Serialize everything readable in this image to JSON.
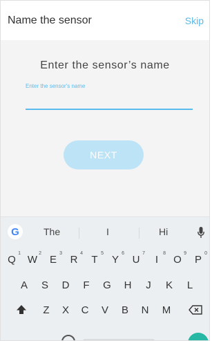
{
  "app_bar": {
    "title": "Name the sensor",
    "skip_label": "Skip"
  },
  "form": {
    "heading": "Enter the sensor’s name",
    "field_label": "Enter the sensor's name",
    "field_value": "",
    "next_label": "NEXT"
  },
  "keyboard": {
    "suggestions": [
      "The",
      "I",
      "Hi"
    ],
    "row1": [
      {
        "key": "Q",
        "num": "1"
      },
      {
        "key": "W",
        "num": "2"
      },
      {
        "key": "E",
        "num": "3"
      },
      {
        "key": "R",
        "num": "4"
      },
      {
        "key": "T",
        "num": "5"
      },
      {
        "key": "Y",
        "num": "6"
      },
      {
        "key": "U",
        "num": "7"
      },
      {
        "key": "I",
        "num": "8"
      },
      {
        "key": "O",
        "num": "9"
      },
      {
        "key": "P",
        "num": "0"
      }
    ],
    "row2": [
      "A",
      "S",
      "D",
      "F",
      "G",
      "H",
      "J",
      "K",
      "L"
    ],
    "row3": [
      "Z",
      "X",
      "C",
      "V",
      "B",
      "N",
      "M"
    ],
    "google_logo": "G"
  },
  "colors": {
    "accent": "#5bbbed",
    "button_disabled": "#bde3f6",
    "enter_key": "#26b8a5"
  },
  "icons": {
    "google": "google-icon",
    "mic": "microphone-icon",
    "shift": "shift-icon",
    "backspace": "backspace-icon"
  }
}
